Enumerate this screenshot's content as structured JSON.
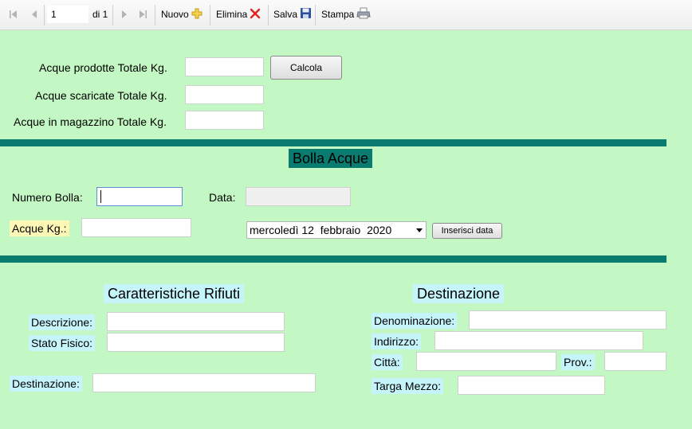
{
  "toolbar": {
    "page_value": "1",
    "page_total": "di 1",
    "new_label": "Nuovo",
    "delete_label": "Elimina",
    "save_label": "Salva",
    "print_label": "Stampa"
  },
  "totals": {
    "produced_label": "Acque prodotte Totale Kg.",
    "discharged_label": "Acque scaricate Totale Kg.",
    "stored_label": "Acque in magazzino Totale Kg.",
    "calc_button": "Calcola"
  },
  "bolla": {
    "title": "Bolla Acque",
    "number_label": "Numero Bolla:",
    "date_label": "Data:",
    "kg_label": "Acque Kg.:",
    "date_picker_value": "mercoledì 12  febbraio  2020",
    "insert_date_button": "Inserisci data"
  },
  "waste": {
    "title": "Caratteristiche Rifiuti",
    "description_label": "Descrizione:",
    "physical_state_label": "Stato Fisico:",
    "destination_label": "Destinazione:"
  },
  "destination": {
    "title": "Destinazione",
    "name_label": "Denominazione:",
    "address_label": "Indirizzo:",
    "city_label": "Città:",
    "province_label": "Prov.:",
    "vehicle_label": "Targa Mezzo:"
  },
  "colors": {
    "background": "#c3f7c3",
    "accent_bar": "#0a7b6f",
    "label_cyan": "#c5f4fb",
    "label_yellow": "#fff7b5"
  }
}
